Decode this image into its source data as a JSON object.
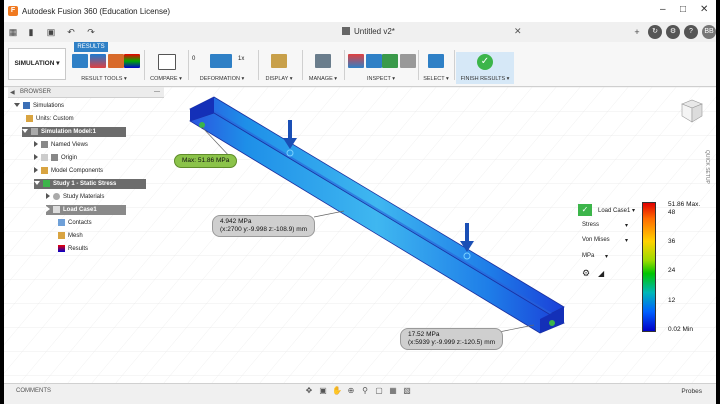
{
  "app": {
    "title": "Autodesk Fusion 360 (Education License)"
  },
  "document": {
    "name": "Untitled v2*"
  },
  "ribbon": {
    "workspace": "SIMULATION",
    "tab": "RESULTS",
    "groups": {
      "result_tools": "RESULT TOOLS",
      "compare": "COMPARE",
      "deformation": "DEFORMATION",
      "display": "DISPLAY",
      "manage": "MANAGE",
      "inspect": "INSPECT",
      "select": "SELECT",
      "finish": "FINISH RESULTS"
    },
    "deform_zero": "0",
    "deform_one": "1x"
  },
  "browser": {
    "header": "BROWSER",
    "items": [
      {
        "label": "Simulations"
      },
      {
        "label": "Units: Custom"
      },
      {
        "label": "Simulation Model:1"
      },
      {
        "label": "Named Views"
      },
      {
        "label": "Origin"
      },
      {
        "label": "Model Components"
      },
      {
        "label": "Study 1 - Static Stress"
      },
      {
        "label": "Study Materials"
      },
      {
        "label": "Load Case1"
      },
      {
        "label": "Contacts"
      },
      {
        "label": "Mesh"
      },
      {
        "label": "Results"
      }
    ]
  },
  "callouts": {
    "max": "Max: 51.86 MPa",
    "probe1_value": "4.942 MPa",
    "probe1_coords": "(x:2700 y:-9.998 z:-108.9) mm",
    "probe2_value": "17.52 MPa",
    "probe2_coords": "(x:5939 y:-9.999 z:-120.5) mm"
  },
  "results_panel": {
    "load_case": "Load Case1",
    "result_type": "Stress",
    "component": "Von Mises",
    "units": "MPa"
  },
  "legend": {
    "max_label": "51.86 Max.",
    "ticks": [
      "48",
      "36",
      "24",
      "12"
    ],
    "min_label": "0.02 Min"
  },
  "bottom": {
    "comments": "COMMENTS",
    "probes": "Probes"
  },
  "quick_setup": "QUICK SETUP",
  "colors": {
    "accent": "#2f80c6",
    "finish_green": "#3cb54a"
  }
}
